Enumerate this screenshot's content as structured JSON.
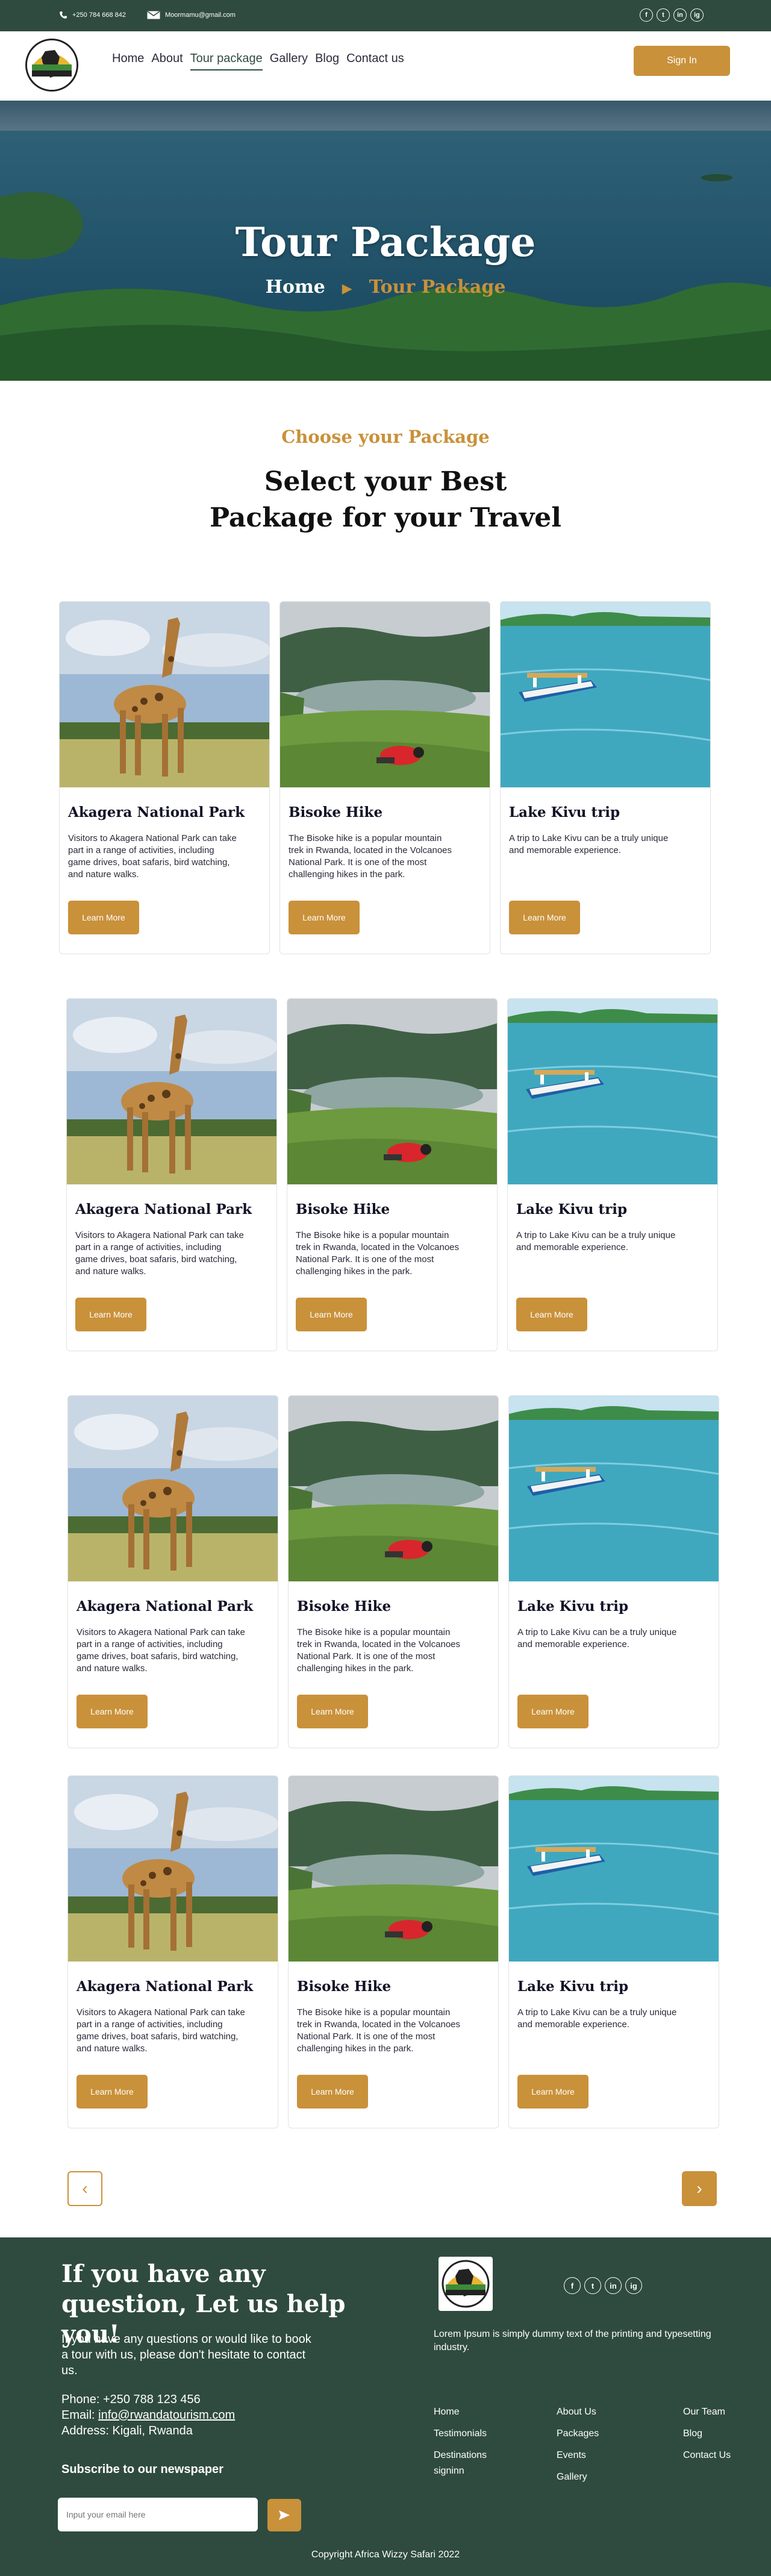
{
  "topbar": {
    "phone": "+250 784 668 842",
    "email": "Moormamu@gmail.com",
    "social": [
      "f",
      "t",
      "in",
      "ig"
    ]
  },
  "nav": {
    "items": [
      "Home",
      "About",
      "Tour package",
      "Gallery",
      "Blog",
      "Contact us"
    ],
    "active": "Tour package",
    "signin_label": "Sign In"
  },
  "hero": {
    "title": "Tour Package",
    "crumb_home": "Home",
    "crumb_current": "Tour Package"
  },
  "section": {
    "eyebrow": "Choose your Package",
    "heading": "Select your Best Package for your Travel"
  },
  "packages": [
    {
      "title": "Akagera National Park",
      "description": "Visitors to Akagera National Park can take part in a range of activities, including game drives, boat safaris, bird watching, and nature walks.",
      "button": "Learn More"
    },
    {
      "title": "Bisoke Hike",
      "description": "The Bisoke hike is a popular mountain trek in Rwanda, located in the Volcanoes National Park. It is one of the most challenging hikes in the park.",
      "button": "Learn More"
    },
    {
      "title": "Lake Kivu trip",
      "description": "A trip to Lake Kivu can be a truly unique and memorable experience.",
      "button": "Learn More"
    }
  ],
  "pagination": {
    "prev": "‹",
    "next": "›"
  },
  "footer": {
    "heading": "If you have any question, Let us help you!",
    "intro": "If you have any questions or would like to book a tour with us, please don't hesitate to contact us.",
    "phone": "Phone: +250 788 123 456",
    "email_label": "Email: ",
    "email": "info@rwandatourism.com",
    "address": "Address: Kigali, Rwanda",
    "subscribe": "Subscribe to our newspaper",
    "input_placeholder": "Input your email here",
    "lorem": "Lorem Ipsum is simply dummy text of the printing and typesetting industry.",
    "col1": [
      "Home",
      "Testimonials",
      "Destinations",
      "signinn"
    ],
    "col2": [
      "About Us",
      "Packages",
      "Events",
      "Gallery"
    ],
    "col3": [
      "Our Team",
      "Blog",
      "Contact Us"
    ],
    "social": [
      "f",
      "t",
      "in",
      "ig"
    ],
    "copyright": "Copyright Africa Wizzy Safari 2022"
  },
  "colors": {
    "green": "#2f4b3f",
    "gold": "#c9913a"
  }
}
